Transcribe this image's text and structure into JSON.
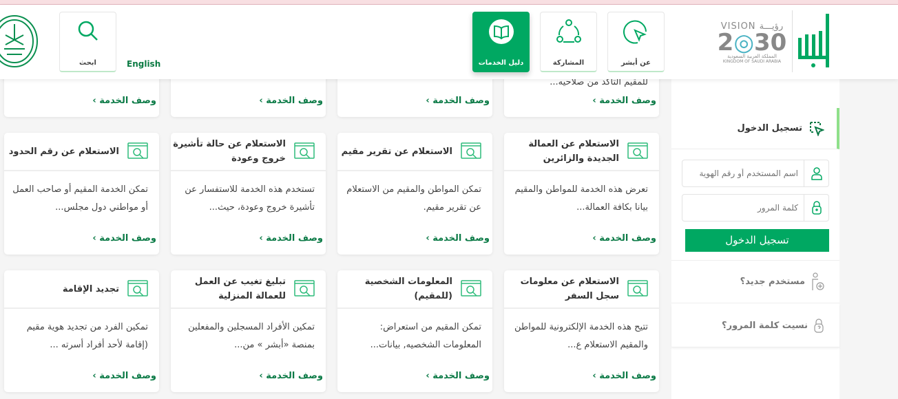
{
  "header": {
    "nav": [
      {
        "label": "عن أبشر",
        "icon": "cursor-circle-icon"
      },
      {
        "label": "المشاركة",
        "icon": "share-network-icon"
      },
      {
        "label": "دليل الخدمات",
        "icon": "book-icon",
        "active": true
      }
    ],
    "language": "English",
    "search_label": "ابحث",
    "logo_vision": "VISION رؤيـــة 2030",
    "logo_vision_sub_ar": "المملكة العربية السعودية",
    "logo_vision_sub_en": "KINGDOM OF SAUDI ARABIA",
    "logo_absher": "أبشر"
  },
  "partial_row": [
    {
      "desc": "للمقيم التأكد من صلاحيه...",
      "more": "وصف الخدمة ›"
    },
    {
      "desc": "",
      "more": "وصف الخدمة ›"
    },
    {
      "desc": "",
      "more": "وصف الخدمة ›"
    },
    {
      "desc": "",
      "more": "وصف الخدمة ›"
    }
  ],
  "cards": [
    {
      "title": "الاستعلام عن العمالة الجديدة والزائرين",
      "desc": "تعرض هذه الخدمة للمواطن والمقيم بيانا بكافة العمالة...",
      "more": "وصف الخدمة ›"
    },
    {
      "title": "الاستعلام عن تقرير مقيم",
      "desc": "تمكن المواطن والمقيم من الاستعلام عن تقرير مقيم.",
      "more": "وصف الخدمة ›"
    },
    {
      "title": "الاستعلام عن حالة تأشيرة خروج وعودة",
      "desc": "تستخدم هذه الخدمة للاستفسار عن تأشيرة خروج وعودة، حيث...",
      "more": "وصف الخدمة ›"
    },
    {
      "title": "الاستعلام عن رقم الحدود",
      "desc": "تمكن الخدمة المقيم أو صاحب العمل أو مواطني دول مجلس...",
      "more": "وصف الخدمة ›"
    },
    {
      "title": "الاستعلام عن معلومات سجل السفر",
      "desc": "تتيح هذه الخدمة الإلكترونية للمواطن والمقيم الاستعلام ع...",
      "more": "وصف الخدمة ›"
    },
    {
      "title": "المعلومات الشخصية (للمقيم)",
      "desc": "تمكن المقيم من استعراض: المعلومات الشخصيه, بيانات...",
      "more": "وصف الخدمة ›"
    },
    {
      "title": "تبليغ تغيب عن العمل للعمالة المنزلية",
      "desc": "تمكين الأفراد المسجلين والمفعلين بمنصة «أبشر » من...",
      "more": "وصف الخدمة ›"
    },
    {
      "title": "تجديد الإقامة",
      "desc": "تمكين الفرد من تجديد هوية مقيم (إقامة لأحد أفراد أسرته ...",
      "more": "وصف الخدمة ›"
    }
  ],
  "login": {
    "title": "تسجيل الدخول",
    "username_placeholder": "اسم المستخدم أو رقم الهوية",
    "password_placeholder": "كلمة المرور",
    "submit": "تسجيل الدخول",
    "new_user": "مستخدم جديد؟",
    "forgot": "نسيت كلمة المرور؟"
  },
  "colors": {
    "brand": "#00a862",
    "link": "#0b7a46",
    "accent_bar": "#8fe08a"
  }
}
